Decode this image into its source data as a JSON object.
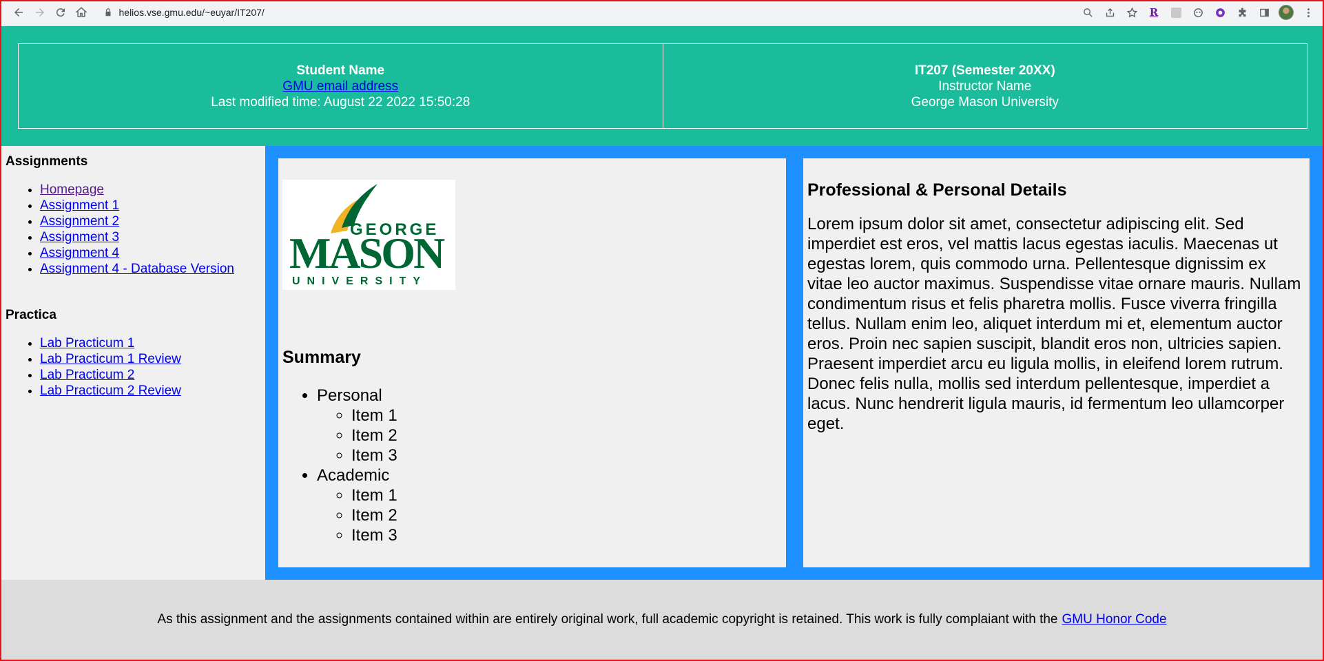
{
  "browser": {
    "url": "helios.vse.gmu.edu/~euyar/IT207/",
    "extension_r_label": "R"
  },
  "header": {
    "student_name": "Student Name",
    "email_link": "GMU email address",
    "last_modified": "Last modified time: August 22 2022 15:50:28",
    "course": "IT207 (Semester 20XX)",
    "instructor": "Instructor Name",
    "university": "George Mason University"
  },
  "sidebar": {
    "assignments_title": "Assignments",
    "assignments": [
      {
        "label": "Homepage"
      },
      {
        "label": "Assignment 1"
      },
      {
        "label": "Assignment 2"
      },
      {
        "label": "Assignment 3"
      },
      {
        "label": "Assignment 4"
      },
      {
        "label": "Assignment 4 - Database Version"
      }
    ],
    "practica_title": "Practica",
    "practica": [
      {
        "label": "Lab Practicum 1"
      },
      {
        "label": "Lab Practicum 1 Review"
      },
      {
        "label": "Lab Practicum 2"
      },
      {
        "label": "Lab Practicum 2 Review"
      }
    ]
  },
  "logo": {
    "word1": "GEORGE",
    "word2": "MASON",
    "word3": "UNIVERSITY"
  },
  "summary": {
    "title": "Summary",
    "groups": [
      {
        "label": "Personal",
        "items": [
          "Item 1",
          "Item 2",
          "Item 3"
        ]
      },
      {
        "label": "Academic",
        "items": [
          "Item 1",
          "Item 2",
          "Item 3"
        ]
      }
    ]
  },
  "details": {
    "title": "Professional & Personal Details",
    "body": "Lorem ipsum dolor sit amet, consectetur adipiscing elit. Sed imperdiet est eros, vel mattis lacus egestas iaculis. Maecenas ut egestas lorem, quis commodo urna. Pellentesque dignissim ex vitae leo auctor maximus. Suspendisse vitae ornare mauris. Nullam condimentum risus et felis pharetra mollis. Fusce viverra fringilla tellus. Nullam enim leo, aliquet interdum mi et, elementum auctor eros. Proin nec sapien suscipit, blandit eros non, ultricies sapien. Praesent imperdiet arcu eu ligula mollis, in eleifend lorem rutrum. Donec felis nulla, mollis sed interdum pellentesque, imperdiet a lacus. Nunc hendrerit ligula mauris, id fermentum leo ullamcorper eget."
  },
  "footer": {
    "text": "As this assignment and the assignments contained within are entirely original work, full academic copyright is retained. This work is fully complaiant with the",
    "link": "GMU Honor Code"
  },
  "colors": {
    "header_bg": "#1abc9c",
    "main_bg": "#1e90ff",
    "panel_bg": "#f0f0f0",
    "footer_bg": "#dcdcdc",
    "gmu_green": "#006633",
    "gmu_gold": "#ffcc33"
  }
}
